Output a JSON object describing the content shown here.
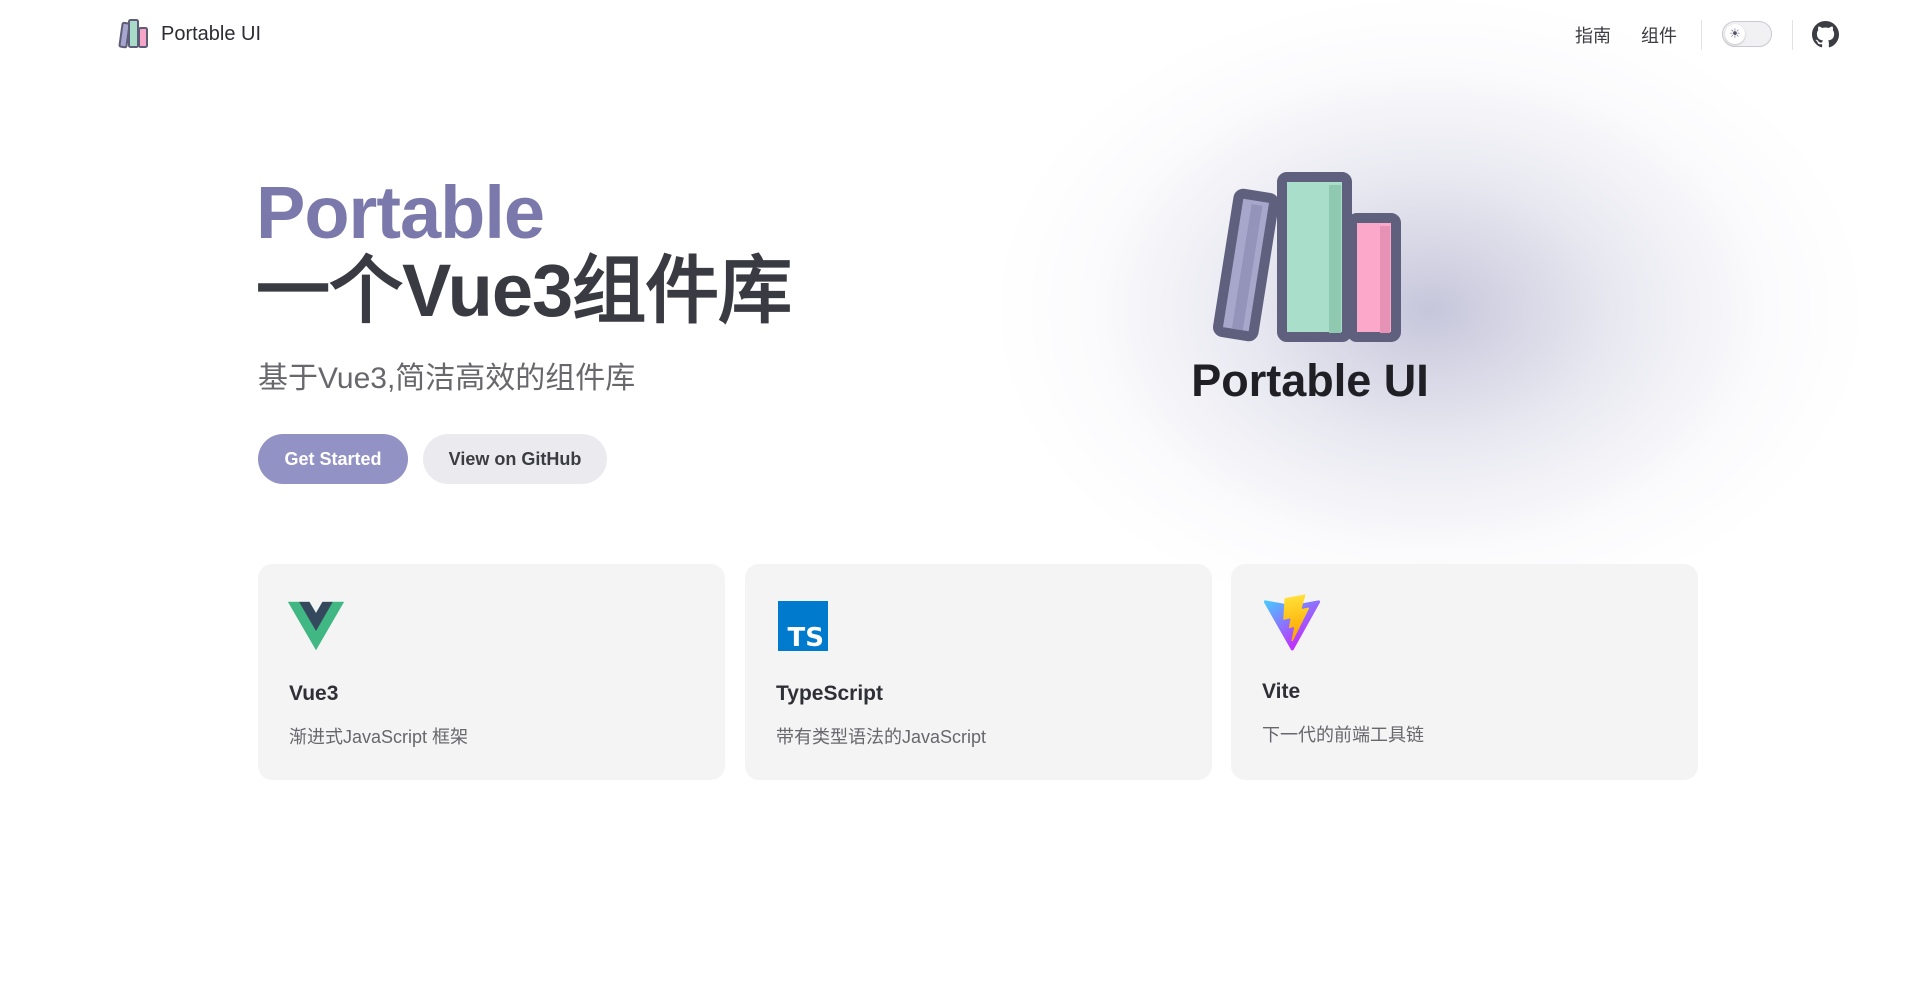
{
  "nav": {
    "brand": "Portable UI",
    "links": [
      "指南",
      "组件"
    ]
  },
  "hero": {
    "name": "Portable",
    "text": "一个Vue3组件库",
    "tagline": "基于Vue3,简洁高效的组件库",
    "primary_action": "Get Started",
    "secondary_action": "View on GitHub",
    "logo_title": "Portable UI"
  },
  "features": [
    {
      "icon": "vue-logo-icon",
      "title": "Vue3",
      "details": "渐进式JavaScript 框架"
    },
    {
      "icon": "typescript-logo-icon",
      "title": "TypeScript",
      "details": "带有类型语法的JavaScript"
    },
    {
      "icon": "vite-logo-icon",
      "title": "Vite",
      "details": "下一代的前端工具链"
    }
  ],
  "colors": {
    "brand": "#7b79ab",
    "brand_button": "#9292c4",
    "card_bg": "#f4f4f5",
    "text": "#3c3c43"
  },
  "icons": [
    "books-logo-icon",
    "sun-icon",
    "github-icon"
  ]
}
